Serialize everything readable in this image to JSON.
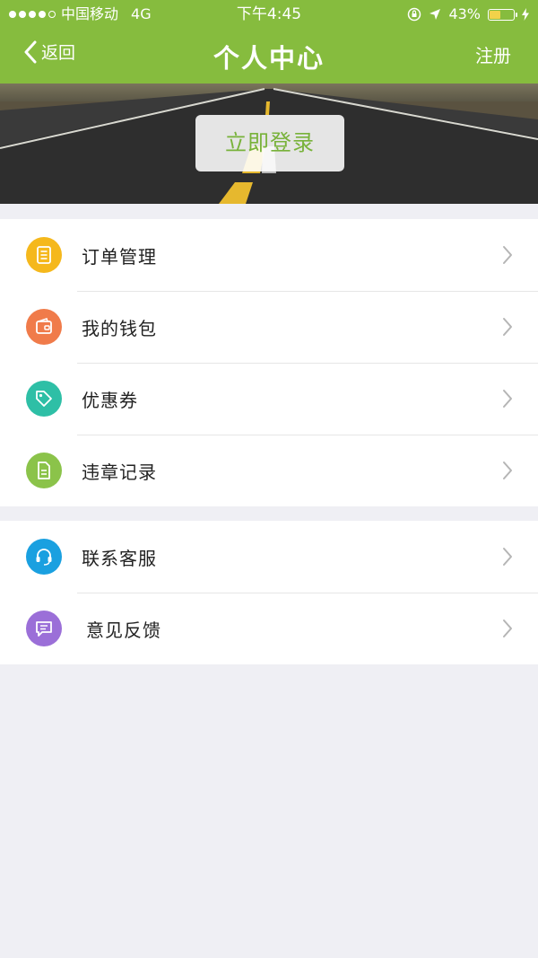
{
  "status_bar": {
    "carrier": "中国移动",
    "network": "4G",
    "time": "下午4:45",
    "battery": "43%",
    "battery_level": 0.43
  },
  "nav": {
    "back_label": "返回",
    "title": "个人中心",
    "register_label": "注册"
  },
  "banner": {
    "login_label": "立即登录"
  },
  "menu_group_1": [
    {
      "label": "订单管理",
      "icon": "order-list-icon",
      "color": "#f5b81c"
    },
    {
      "label": "我的钱包",
      "icon": "wallet-icon",
      "color": "#f07b4a"
    },
    {
      "label": "优惠券",
      "icon": "coupon-tag-icon",
      "color": "#2ebfa6"
    },
    {
      "label": "违章记录",
      "icon": "document-icon",
      "color": "#8bc34a"
    }
  ],
  "menu_group_2": [
    {
      "label": "联系客服",
      "icon": "headset-icon",
      "color": "#1aa0e0"
    },
    {
      "label": "意见反馈",
      "icon": "chat-bubble-icon",
      "color": "#9b6fd8"
    }
  ],
  "colors": {
    "accent": "#86bc3e",
    "background": "#efeff4"
  }
}
